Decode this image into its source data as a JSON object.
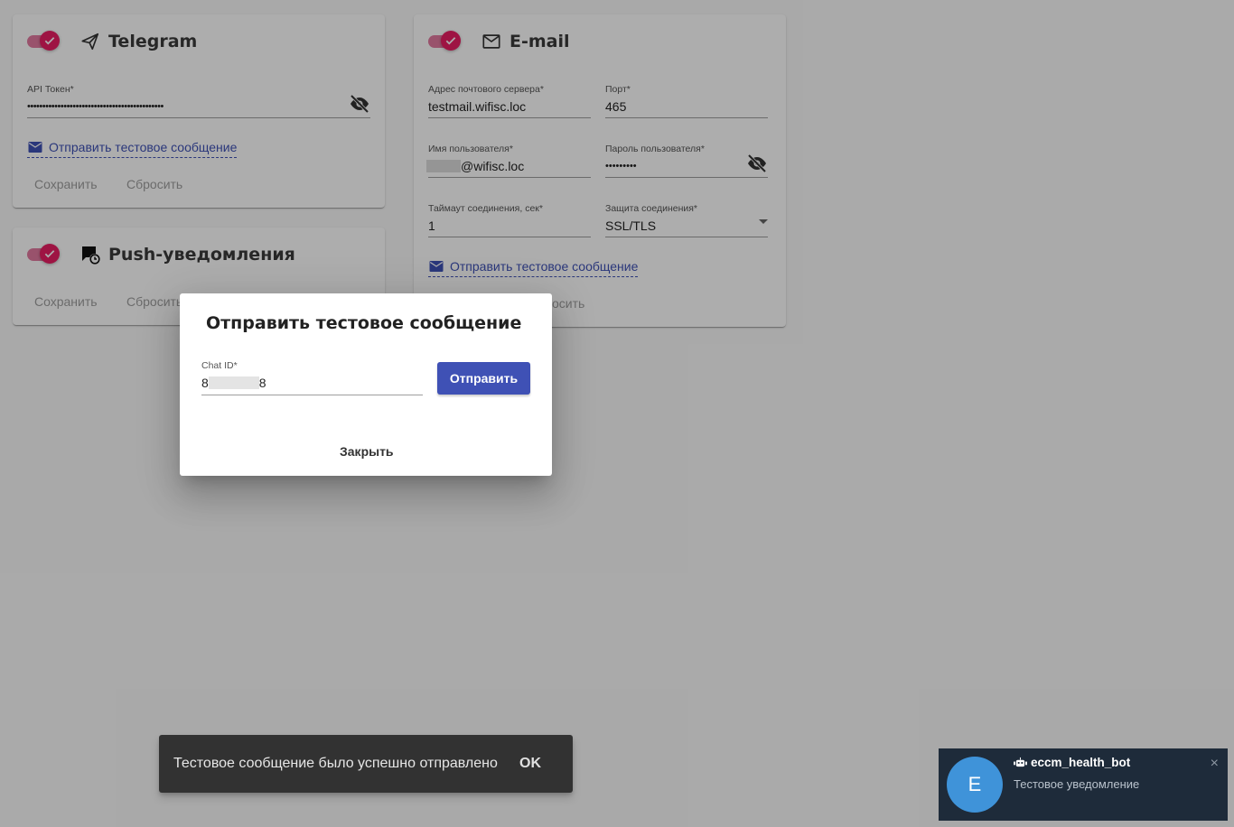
{
  "telegram": {
    "title": "Telegram",
    "token_label": "API Токен*",
    "token_value": "•••••••••••••••••••••••••••••••••••••••••••••",
    "test_link": "Отправить тестовое сообщение",
    "save": "Сохранить",
    "reset": "Сбросить",
    "icon": "send-icon"
  },
  "push": {
    "title": "Push-уведомления",
    "save": "Сохранить",
    "reset": "Сбросить",
    "icon": "chat-clock-icon"
  },
  "email": {
    "title": "E-mail",
    "server_label": "Адрес почтового сервера*",
    "server_value": "testmail.wifisc.loc",
    "port_label": "Порт*",
    "port_value": "465",
    "user_label": "Имя пользователя*",
    "user_value_suffix": "@wifisc.loc",
    "password_label": "Пароль пользователя*",
    "password_value": "•••••••••",
    "timeout_label": "Таймаут соединения, сек*",
    "timeout_value": "1",
    "security_label": "Защита соединения*",
    "security_value": "SSL/TLS",
    "test_link": "Отправить тестовое сообщение",
    "reset_partial": "осить",
    "icon": "mail-icon"
  },
  "dialog": {
    "title": "Отправить тестовое сообщение",
    "chat_label": "Chat ID*",
    "chat_prefix": "8",
    "chat_suffix": "8",
    "send": "Отправить",
    "close": "Закрыть"
  },
  "snackbar": {
    "message": "Тестовое сообщение было успешно отправлено",
    "action": "OK"
  },
  "notification": {
    "avatar_letter": "E",
    "bot_name": "eccm_health_bot",
    "text": "Тестовое уведомление",
    "close": "×"
  },
  "colors": {
    "accent": "#e91e63",
    "primary": "#3f51b5",
    "overlay": "rgba(0,0,0,0.32)"
  }
}
